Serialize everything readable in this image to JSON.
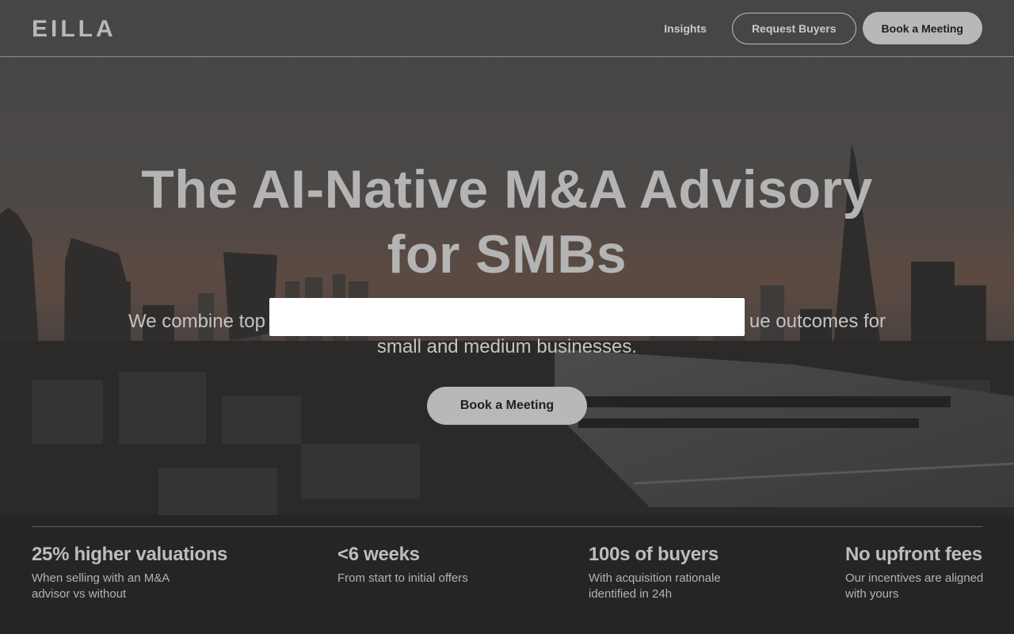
{
  "nav": {
    "logo": "EILLA",
    "links": [
      {
        "label": "Insights"
      }
    ],
    "request_buyers": "Request Buyers",
    "book_meeting": "Book a Meeting"
  },
  "hero": {
    "headline_line1": "The AI-Native M&A Advisory",
    "headline_line2": "for SMBs",
    "subtext_line1_left": "We combine top",
    "subtext_line1_right": "ue outcomes for",
    "subtext_line2": "small and medium businesses.",
    "cta": "Book a Meeting"
  },
  "stats": [
    {
      "title": "25% higher valuations",
      "desc_line1": "When selling with an M&A",
      "desc_line2": "advisor vs without"
    },
    {
      "title": "<6 weeks",
      "desc_line1": "From start to initial offers",
      "desc_line2": ""
    },
    {
      "title": "100s of buyers",
      "desc_line1": "With acquisition rationale",
      "desc_line2": "identified in 24h"
    },
    {
      "title": "No upfront fees",
      "desc_line1": "Our incentives are aligned",
      "desc_line2": "with yours"
    }
  ],
  "colors": {
    "button_fill": "#b8b8b8",
    "text": "#bdbdbd",
    "redaction": "#ffffff"
  }
}
